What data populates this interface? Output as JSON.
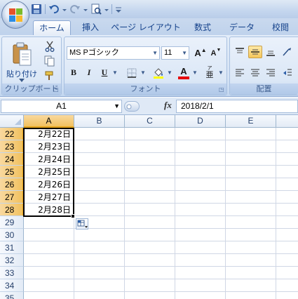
{
  "tabs": [
    {
      "label": "ホーム",
      "active": true
    },
    {
      "label": "挿入",
      "active": false
    },
    {
      "label": "ページ レイアウト",
      "active": false
    },
    {
      "label": "数式",
      "active": false
    },
    {
      "label": "データ",
      "active": false
    },
    {
      "label": "校閲",
      "active": false
    }
  ],
  "clipboard": {
    "paste_label": "貼り付け",
    "group_label": "クリップボード"
  },
  "font": {
    "name": "MS Pゴシック",
    "size": "11",
    "group_label": "フォント",
    "bold": "B",
    "italic": "I",
    "underline": "U",
    "grow": "A",
    "shrink": "A",
    "font_color": "A",
    "phonetic": "亜"
  },
  "alignment": {
    "group_label": "配置"
  },
  "formula_bar": {
    "cell_ref": "A1",
    "fx": "fx",
    "value": "2018/2/1"
  },
  "sheet": {
    "columns": [
      "A",
      "B",
      "C",
      "D",
      "E"
    ],
    "selected_column": "A",
    "rows": [
      {
        "num": "22",
        "a": "2月22日",
        "selected": true
      },
      {
        "num": "23",
        "a": "2月23日",
        "selected": true
      },
      {
        "num": "24",
        "a": "2月24日",
        "selected": true
      },
      {
        "num": "25",
        "a": "2月25日",
        "selected": true
      },
      {
        "num": "26",
        "a": "2月26日",
        "selected": true
      },
      {
        "num": "27",
        "a": "2月27日",
        "selected": true
      },
      {
        "num": "28",
        "a": "2月28日",
        "selected": true
      },
      {
        "num": "29",
        "a": "",
        "selected": false
      },
      {
        "num": "30",
        "a": "",
        "selected": false
      },
      {
        "num": "31",
        "a": "",
        "selected": false
      },
      {
        "num": "32",
        "a": "",
        "selected": false
      },
      {
        "num": "33",
        "a": "",
        "selected": false
      },
      {
        "num": "34",
        "a": "",
        "selected": false
      },
      {
        "num": "35",
        "a": "",
        "selected": false
      }
    ]
  },
  "colors": {
    "accent_selected": "#f1c15f",
    "ribbon": "#d5e3f5",
    "text": "#15428b"
  }
}
